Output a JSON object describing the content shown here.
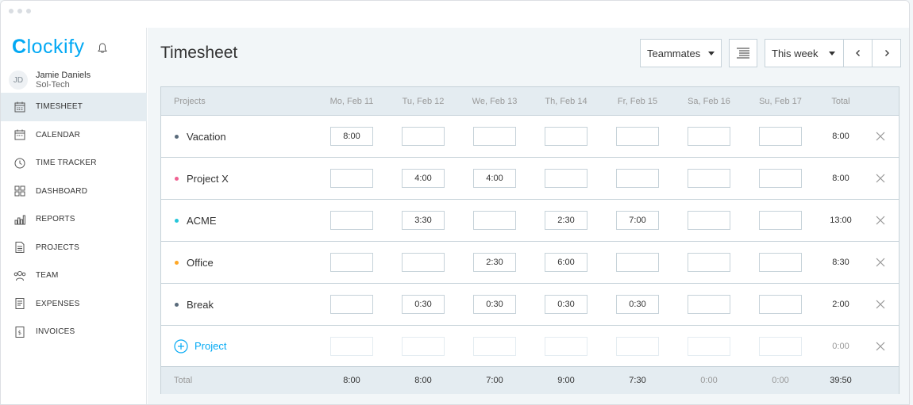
{
  "app": {
    "logo_mark": "C",
    "logo_rest": "lockify"
  },
  "user": {
    "initials": "JD",
    "name": "Jamie Daniels",
    "org": "Sol-Tech"
  },
  "nav": [
    {
      "label": "TIMESHEET",
      "icon": "timesheet-icon"
    },
    {
      "label": "CALENDAR",
      "icon": "calendar-icon"
    },
    {
      "label": "TIME TRACKER",
      "icon": "clock-icon"
    },
    {
      "label": "DASHBOARD",
      "icon": "dashboard-icon"
    },
    {
      "label": "REPORTS",
      "icon": "reports-icon"
    },
    {
      "label": "PROJECTS",
      "icon": "projects-icon"
    },
    {
      "label": "TEAM",
      "icon": "team-icon"
    },
    {
      "label": "EXPENSES",
      "icon": "expenses-icon"
    },
    {
      "label": "INVOICES",
      "icon": "invoices-icon"
    }
  ],
  "page": {
    "title": "Timesheet"
  },
  "toolbar": {
    "teammates_label": "Teammates",
    "range_label": "This week"
  },
  "colors": {
    "accent": "#03a9f4",
    "header_bg": "#e4ecf1",
    "border": "#c6d2d9"
  },
  "table": {
    "headers": [
      "Projects",
      "Mo, Feb 11",
      "Tu, Feb 12",
      "We, Feb 13",
      "Th, Feb 14",
      "Fr, Feb 15",
      "Sa, Feb 16",
      "Su, Feb 17",
      "Total"
    ],
    "rows": [
      {
        "name": "Vacation",
        "color": "#5a6b7b",
        "cells": [
          "8:00",
          "",
          "",
          "",
          "",
          "",
          ""
        ],
        "total": "8:00"
      },
      {
        "name": "Project X",
        "color": "#f06292",
        "cells": [
          "",
          "4:00",
          "4:00",
          "",
          "",
          "",
          ""
        ],
        "total": "8:00"
      },
      {
        "name": "ACME",
        "color": "#26c6da",
        "cells": [
          "",
          "3:30",
          "",
          "2:30",
          "7:00",
          "",
          ""
        ],
        "total": "13:00"
      },
      {
        "name": "Office",
        "color": "#ffa726",
        "cells": [
          "",
          "",
          "2:30",
          "6:00",
          "",
          "",
          ""
        ],
        "total": "8:30"
      },
      {
        "name": "Break",
        "color": "#5a6b7b",
        "cells": [
          "",
          "0:30",
          "0:30",
          "0:30",
          "0:30",
          "",
          ""
        ],
        "total": "2:00"
      }
    ],
    "add_row": {
      "label": "Project",
      "total": "0:00"
    },
    "footer": {
      "label": "Total",
      "values": [
        "8:00",
        "8:00",
        "7:00",
        "9:00",
        "7:30",
        "0:00",
        "0:00"
      ],
      "total": "39:50"
    }
  }
}
